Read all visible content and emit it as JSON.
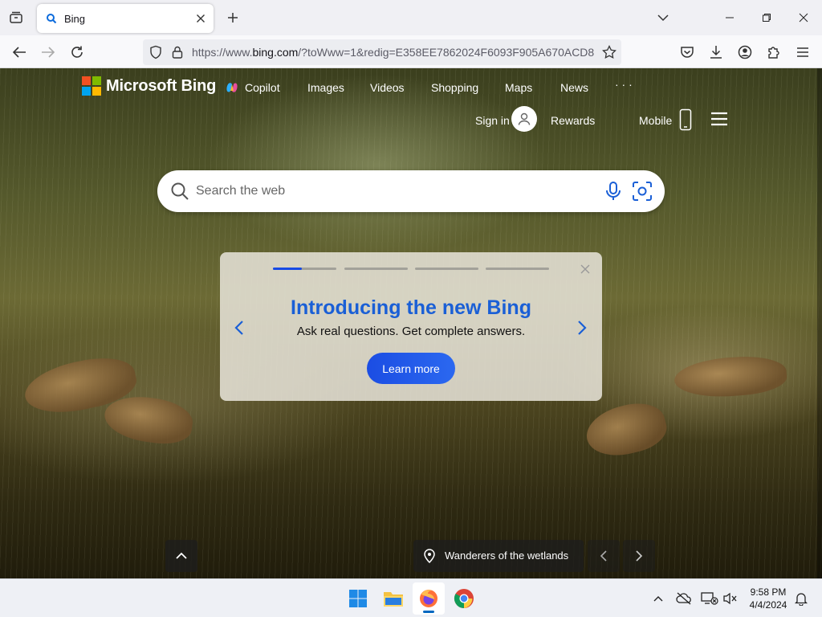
{
  "browser": {
    "tab": {
      "title": "Bing"
    },
    "url": {
      "scheme": "https://www.",
      "host": "bing.com",
      "rest": "/?toWww=1&redig=E358EE7862024F6093F905A670ACD8"
    }
  },
  "bing": {
    "brand": "Microsoft Bing",
    "nav": {
      "copilot": "Copilot",
      "images": "Images",
      "videos": "Videos",
      "shopping": "Shopping",
      "maps": "Maps",
      "news": "News",
      "more": "· · ·"
    },
    "header": {
      "signin": "Sign in",
      "rewards": "Rewards",
      "mobile": "Mobile"
    },
    "search": {
      "placeholder": "Search the web"
    },
    "promo": {
      "title": "Introducing the new Bing",
      "subtitle": "Ask real questions. Get complete answers.",
      "cta": "Learn more",
      "active_slide_progress": 0.45,
      "slides": 4
    },
    "image_title": "Wanderers of the wetlands"
  },
  "taskbar": {
    "time": "9:58 PM",
    "date": "4/4/2024"
  },
  "colors": {
    "accent": "#174ae4",
    "promo_title": "#1a5fd6",
    "ms_red": "#f25022",
    "ms_green": "#7fba00",
    "ms_blue": "#00a4ef",
    "ms_yellow": "#ffb900"
  },
  "icons": {
    "tab_list": "tab-list-icon",
    "favicon": "bing-favicon-icon",
    "tab_close": "close-icon",
    "new_tab": "plus-icon",
    "back": "back-arrow-icon",
    "forward": "forward-arrow-icon",
    "reload": "reload-icon",
    "shield": "shield-icon",
    "lock": "lock-icon",
    "bookmark": "star-icon",
    "pocket": "pocket-icon",
    "downloads": "download-icon",
    "account": "account-icon",
    "extensions": "puzzle-icon",
    "menu": "hamburger-menu-icon",
    "search": "search-icon",
    "mic": "microphone-icon",
    "visual_search": "camera-search-icon",
    "location": "location-pin-icon",
    "scroll_up": "chevron-up-icon"
  }
}
